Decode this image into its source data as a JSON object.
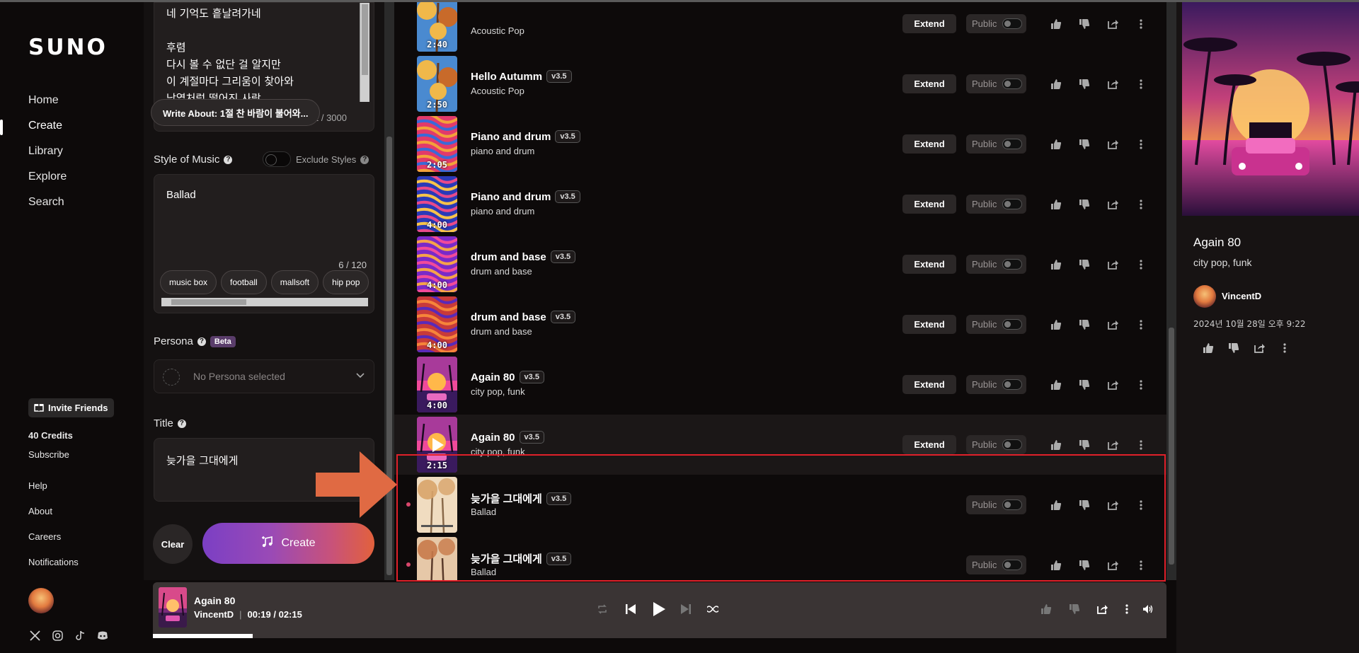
{
  "sidebar": {
    "logo": "SUNO",
    "nav": [
      "Home",
      "Create",
      "Library",
      "Explore",
      "Search"
    ],
    "invite_label": "Invite Friends",
    "credits": "40 Credits",
    "subscribe": "Subscribe",
    "links": [
      "Help",
      "About",
      "Careers",
      "Notifications"
    ]
  },
  "create_panel": {
    "lyrics": "네 기억도 흩날려가네\n\n후렴\n다시 볼 수 없단 걸 알지만\n이 계절마다 그리움이 찾아와\n낙엽처럼 떨어진 사랑",
    "write_about": "Write About: 1절 찬 바람이 불어와...",
    "lyrics_count": "1 / 3000",
    "style_label": "Style of Music",
    "exclude_label": "Exclude Styles",
    "style_value": "Ballad",
    "style_count": "6 / 120",
    "style_chips": [
      "music box",
      "football",
      "mallsoft",
      "hip pop"
    ],
    "persona_label": "Persona",
    "persona_badge": "Beta",
    "persona_placeholder": "No Persona selected",
    "title_label": "Title",
    "title_value": "늦가을 그대에게",
    "clear_label": "Clear",
    "create_label": "Create"
  },
  "songs": [
    {
      "title": "",
      "version": "",
      "subtitle": "Acoustic Pop",
      "duration": "2:40",
      "extend": "Extend",
      "visibility": "Public",
      "art": "autumn",
      "new": false
    },
    {
      "title": "Hello Autumm",
      "version": "v3.5",
      "subtitle": "Acoustic Pop",
      "duration": "2:50",
      "extend": "Extend",
      "visibility": "Public",
      "art": "autumn",
      "new": false
    },
    {
      "title": "Piano and drum",
      "version": "v3.5",
      "subtitle": "piano and drum",
      "duration": "2:05",
      "extend": "Extend",
      "visibility": "Public",
      "art": "swirl",
      "new": false
    },
    {
      "title": "Piano and drum",
      "version": "v3.5",
      "subtitle": "piano and drum",
      "duration": "4:00",
      "extend": "Extend",
      "visibility": "Public",
      "art": "swirl2",
      "new": false
    },
    {
      "title": "drum and base",
      "version": "v3.5",
      "subtitle": "drum and base",
      "duration": "4:00",
      "extend": "Extend",
      "visibility": "Public",
      "art": "swirl3",
      "new": false
    },
    {
      "title": "drum and base",
      "version": "v3.5",
      "subtitle": "drum and base",
      "duration": "4:00",
      "extend": "Extend",
      "visibility": "Public",
      "art": "swirl4",
      "new": false
    },
    {
      "title": "Again 80",
      "version": "v3.5",
      "subtitle": "city pop, funk",
      "duration": "4:00",
      "extend": "Extend",
      "visibility": "Public",
      "art": "synth",
      "new": false
    },
    {
      "title": "Again 80",
      "version": "v3.5",
      "subtitle": "city pop, funk",
      "duration": "2:15",
      "extend": "Extend",
      "visibility": "Public",
      "art": "synth",
      "new": false,
      "highlight": true
    },
    {
      "title": "늦가을 그대에게",
      "version": "v3.5",
      "subtitle": "Ballad",
      "duration": "",
      "extend": "",
      "visibility": "Public",
      "art": "fall",
      "new": true
    },
    {
      "title": "늦가을 그대에게",
      "version": "v3.5",
      "subtitle": "Ballad",
      "duration": "",
      "extend": "",
      "visibility": "Public",
      "art": "fall2",
      "new": true
    }
  ],
  "detail": {
    "title": "Again 80",
    "tags": "city pop,  funk",
    "user": "VincentD",
    "date": "2024년 10월 28일 오후 9:22"
  },
  "player": {
    "title": "Again 80",
    "artist": "VincentD",
    "time": "00:19 / 02:15",
    "progress": 0.0984
  },
  "colors": {
    "accent_red": "#e0202a",
    "arrow": "#e06a43",
    "new_dot": "#d9466b"
  }
}
